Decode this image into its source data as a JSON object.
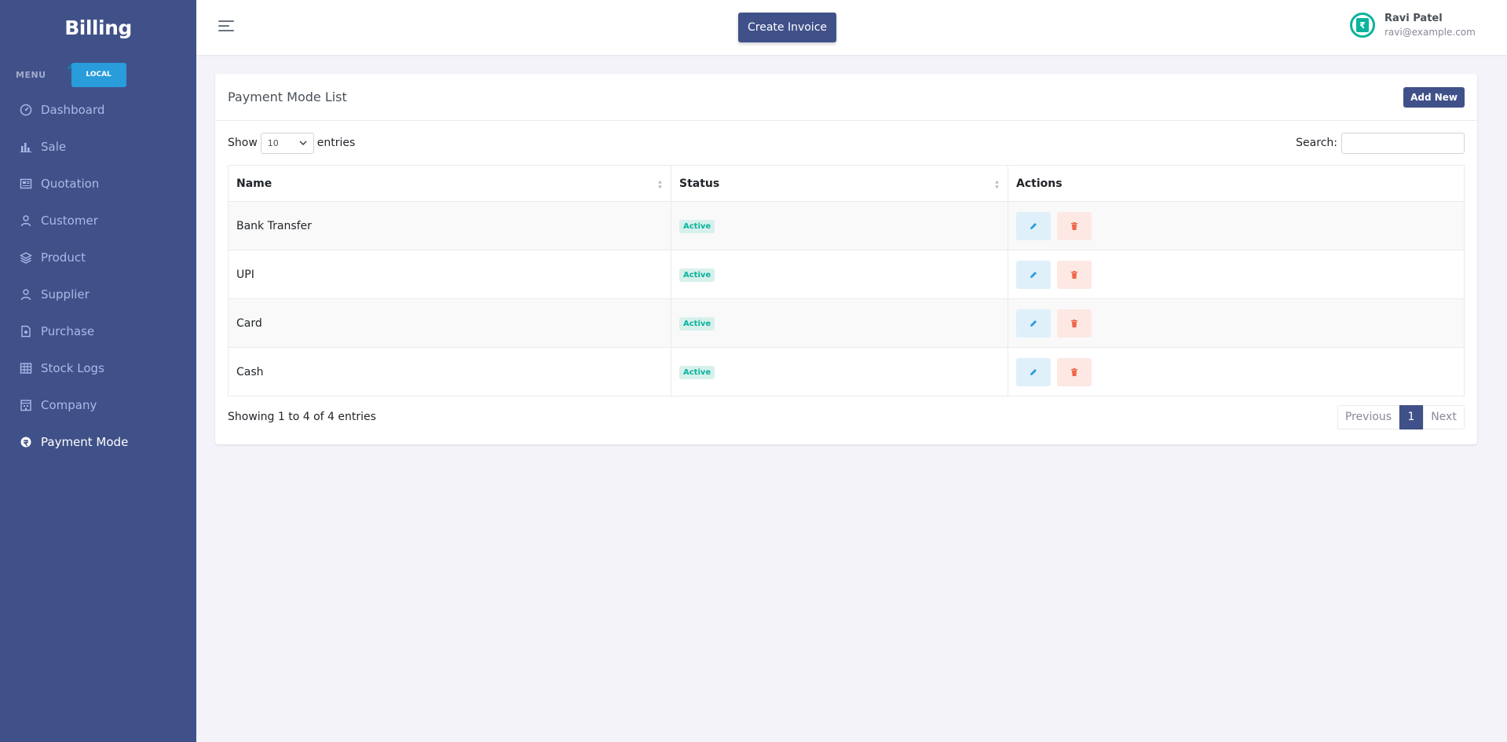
{
  "app": {
    "brand": "Billing"
  },
  "sidebar": {
    "menu_title": "MENU",
    "badge": "LOCAL",
    "items": [
      {
        "label": "Dashboard",
        "icon": "dashboard-gauge-icon",
        "active": false
      },
      {
        "label": "Sale",
        "icon": "bar-chart-icon",
        "active": false
      },
      {
        "label": "Quotation",
        "icon": "newspaper-icon",
        "active": false
      },
      {
        "label": "Customer",
        "icon": "user-icon",
        "active": false
      },
      {
        "label": "Product",
        "icon": "layers-icon",
        "active": false
      },
      {
        "label": "Supplier",
        "icon": "user-icon",
        "active": false
      },
      {
        "label": "Purchase",
        "icon": "file-icon",
        "active": false
      },
      {
        "label": "Stock Logs",
        "icon": "table-grid-icon",
        "active": false
      },
      {
        "label": "Company",
        "icon": "building-icon",
        "active": false
      },
      {
        "label": "Payment Mode",
        "icon": "payment-icon",
        "active": true
      }
    ]
  },
  "header": {
    "create_invoice": "Create Invoice",
    "user": {
      "name": "Ravi Patel",
      "email": "ravi@example.com",
      "avatar_symbol": "₹"
    }
  },
  "card": {
    "title": "Payment Mode List",
    "add_new": "Add New",
    "show_label": "Show",
    "entries_value": "10",
    "entries_label": "entries",
    "search_label": "Search:",
    "search_value": "",
    "columns": [
      "Name",
      "Status",
      "Actions"
    ],
    "rows": [
      {
        "name": "Bank Transfer",
        "status": "Active"
      },
      {
        "name": "UPI",
        "status": "Active"
      },
      {
        "name": "Card",
        "status": "Active"
      },
      {
        "name": "Cash",
        "status": "Active"
      }
    ],
    "info": "Showing 1 to 4 of 4 entries",
    "pagination": {
      "previous": "Previous",
      "current": "1",
      "next": "Next"
    }
  },
  "colors": {
    "primary": "#405189",
    "sidebar_bg": "#405189",
    "info": "#299cdb",
    "success": "#0ab39c",
    "danger": "#f06548",
    "page_bg": "#f3f3f9"
  }
}
